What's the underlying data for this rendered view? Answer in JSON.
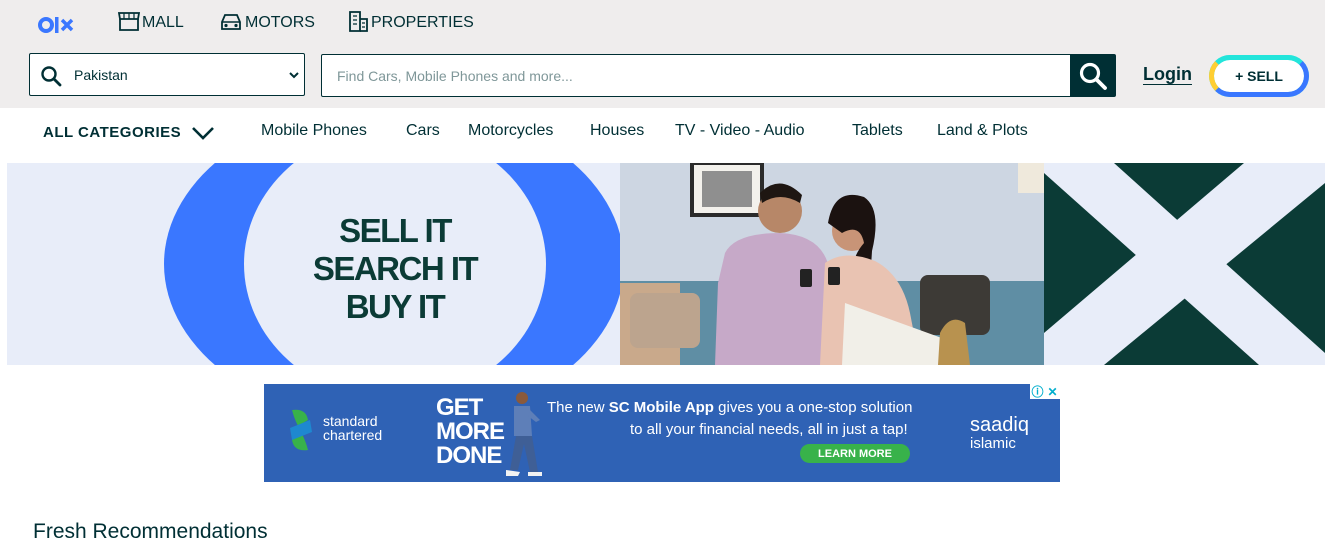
{
  "header": {
    "logo_text": "olx",
    "top_links": [
      {
        "label": "MALL",
        "icon": "mall-icon"
      },
      {
        "label": "MOTORS",
        "icon": "car-icon"
      },
      {
        "label": "PROPERTIES",
        "icon": "building-icon"
      }
    ],
    "location": {
      "value": "Pakistan",
      "icon": "search-icon"
    },
    "search": {
      "placeholder": "Find Cars, Mobile Phones and more..."
    },
    "login_label": "Login",
    "sell_label": "+ SELL"
  },
  "categories": {
    "all_label": "ALL CATEGORIES",
    "items": [
      "Mobile Phones",
      "Cars",
      "Motorcycles",
      "Houses",
      "TV - Video - Audio",
      "Tablets",
      "Land & Plots"
    ]
  },
  "hero": {
    "slogan_lines": [
      "SELL IT",
      "SEARCH IT",
      "BUY IT"
    ]
  },
  "ad": {
    "brand_line1": "standard",
    "brand_line2": "chartered",
    "headline_lines": [
      "GET",
      "MORE",
      "DONE"
    ],
    "text_prefix": "The new ",
    "text_bold": "SC Mobile App",
    "text_suffix": " gives you a one-stop solution",
    "text_line2": "to all your financial needs, all in just a tap!",
    "cta_label": "LEARN MORE",
    "partner_line1": "saadiq",
    "partner_line2": "islamic",
    "info_icon": "ⓘ",
    "close_icon": "✕"
  },
  "section_title": "Fresh Recommendations",
  "colors": {
    "brand": "#002f34",
    "accent_blue": "#3a77ff",
    "accent_teal": "#23e5db",
    "accent_yellow": "#ffce32",
    "hero_dark": "#0b3b36",
    "ad_blue": "#2f62b5"
  }
}
